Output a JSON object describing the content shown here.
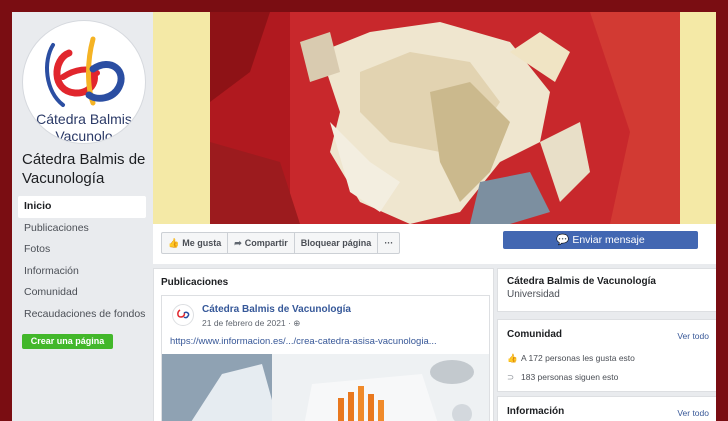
{
  "page": {
    "name": "Cátedra Balmis de Vacunología",
    "logo_text": "Cátedra Balmis"
  },
  "nav": {
    "items": [
      {
        "label": "Inicio"
      },
      {
        "label": "Publicaciones"
      },
      {
        "label": "Fotos"
      },
      {
        "label": "Información"
      },
      {
        "label": "Comunidad"
      },
      {
        "label": "Recaudaciones de fondos"
      }
    ],
    "active": "Inicio",
    "create_page": "Crear una página"
  },
  "actions": {
    "like": "Me gusta",
    "share": "Compartir",
    "block": "Bloquear página",
    "more": "···",
    "send_message": "Enviar mensaje"
  },
  "posts": {
    "heading": "Publicaciones",
    "items": [
      {
        "author": "Cátedra Balmis de Vacunología",
        "date": "21 de febrero de 2021 · ",
        "link": "https://www.informacion.es/.../crea-catedra-asisa-vacunologia..."
      }
    ]
  },
  "about_card": {
    "title": "Cátedra Balmis de Vacunología",
    "category": "Universidad"
  },
  "community": {
    "title": "Comunidad",
    "see_all": "Ver todo",
    "likes_text": "A 172 personas les gusta esto",
    "follows_text": "183 personas siguen esto"
  },
  "info": {
    "title": "Información",
    "see_all": "Ver todo"
  },
  "icons": {
    "like": "thumbs-up-icon",
    "share": "share-arrow-icon",
    "messenger": "messenger-icon",
    "globe": "globe-icon",
    "follow": "rss-icon"
  },
  "colors": {
    "frame": "#7a0d12",
    "brand_blue": "#4267b2",
    "link": "#385898",
    "create_button": "#42b72a"
  }
}
